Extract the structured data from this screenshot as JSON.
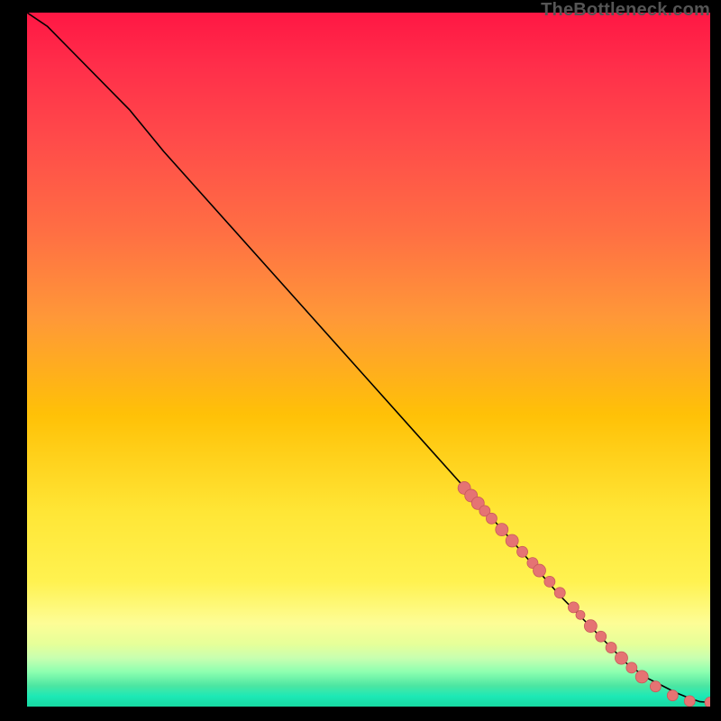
{
  "watermark": "TheBottleneck.com",
  "colors": {
    "line": "#000000",
    "point_fill": "#e57373",
    "point_stroke": "#c85a5a",
    "bg_top": "#ff1744",
    "bg_bottom": "#1de9b6",
    "page_bg": "#000000"
  },
  "chart_data": {
    "type": "line",
    "title": "",
    "xlabel": "",
    "ylabel": "",
    "xlim": [
      0,
      100
    ],
    "ylim": [
      0,
      100
    ],
    "grid": false,
    "legend": false,
    "annotations": [
      "TheBottleneck.com"
    ],
    "series": [
      {
        "name": "curve",
        "kind": "line",
        "x": [
          0,
          3,
          6,
          10,
          15,
          20,
          30,
          40,
          50,
          60,
          70,
          78,
          84,
          88,
          91,
          93,
          95,
          97,
          98.5,
          100
        ],
        "y": [
          100,
          98,
          95,
          91,
          86,
          80,
          69,
          58,
          47,
          36,
          25,
          16,
          10,
          6,
          4,
          3,
          2,
          1.2,
          0.7,
          0.6
        ]
      },
      {
        "name": "points",
        "kind": "scatter",
        "x": [
          64,
          65,
          66,
          67,
          68,
          69.5,
          71,
          72.5,
          74,
          75,
          76.5,
          78,
          80,
          81,
          82.5,
          84,
          85.5,
          87,
          88.5,
          90,
          92,
          94.5,
          97,
          100
        ],
        "y": [
          31.5,
          30.4,
          29.3,
          28.2,
          27.1,
          25.5,
          23.9,
          22.3,
          20.7,
          19.6,
          18,
          16.4,
          14.3,
          13.2,
          11.6,
          10.1,
          8.5,
          7,
          5.6,
          4.3,
          2.9,
          1.6,
          0.8,
          0.6
        ],
        "r": [
          7,
          7,
          7,
          6,
          6,
          7,
          7,
          6,
          6,
          7,
          6,
          6,
          6,
          5,
          7,
          6,
          6,
          7,
          6,
          7,
          6,
          6,
          6,
          6
        ]
      }
    ]
  }
}
